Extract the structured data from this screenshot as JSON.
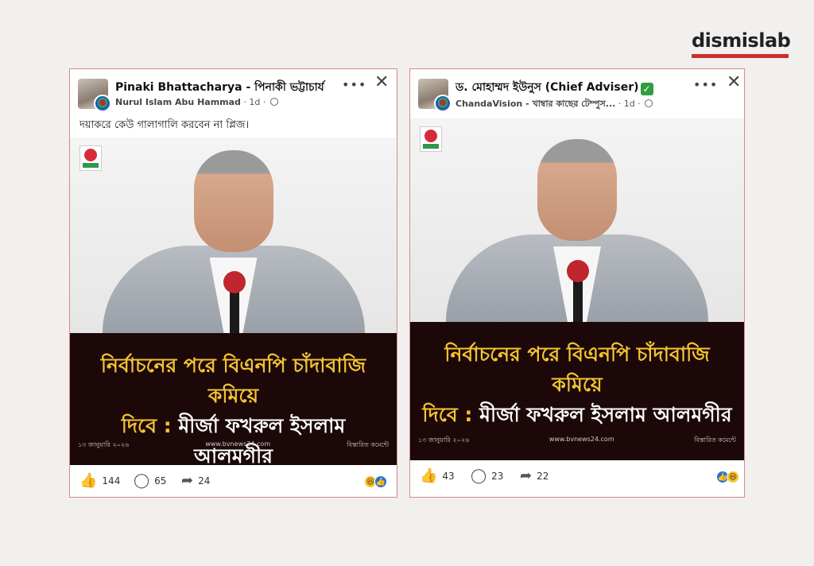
{
  "brand": {
    "logo_text": "dismislab"
  },
  "posts": [
    {
      "author": "Pinaki Bhattacharya - পিনাকী ভট্টাচার্য",
      "group": "Nurul Islam Abu Hammad",
      "time": "1d",
      "caption": "দয়াকরে কেউ গালাগালি করবেন না প্লিজ।",
      "headline_yellow": "নির্বাচনের পরে বিএনপি চাঁদাবাজি কমিয়ে",
      "headline_line2_yellow": "দিবে : ",
      "headline_line2_white": "মীর্জা ফখরুল ইসলাম আলমগীর",
      "footer_date": "১৩ জানুয়ারি ২০২৬",
      "footer_site": "www.bvnews24.com",
      "footer_more": "বিস্তারিত কমেন্টে",
      "likes": "144",
      "comments": "65",
      "shares": "24"
    },
    {
      "author": "ড. মোহাম্মদ ইউনুস (Chief Adviser)",
      "group": "ChandaVision - খাম্বার কাছের টেম্পুস...",
      "time": "1d",
      "caption": "",
      "headline_yellow": "নির্বাচনের পরে বিএনপি চাঁদাবাজি কমিয়ে",
      "headline_line2_yellow": "দিবে : ",
      "headline_line2_white": "মীর্জা ফখরুল ইসলাম আলমগীর",
      "footer_date": "১৩ জানুয়ারি ২০২৬",
      "footer_site": "www.bvnews24.com",
      "footer_more": "বিস্তারিত কমেন্টে",
      "likes": "43",
      "comments": "23",
      "shares": "22"
    }
  ],
  "icons": {
    "more": "more-options-icon",
    "close": "close-icon",
    "like": "thumbs-up-icon",
    "comment": "comment-icon",
    "share": "share-icon",
    "verified": "verified-check-icon",
    "globe": "globe-icon"
  },
  "colors": {
    "accent": "#c9302c",
    "headline": "#f3c431",
    "banner": "#1c0808",
    "verified": "#2e9e3e"
  }
}
